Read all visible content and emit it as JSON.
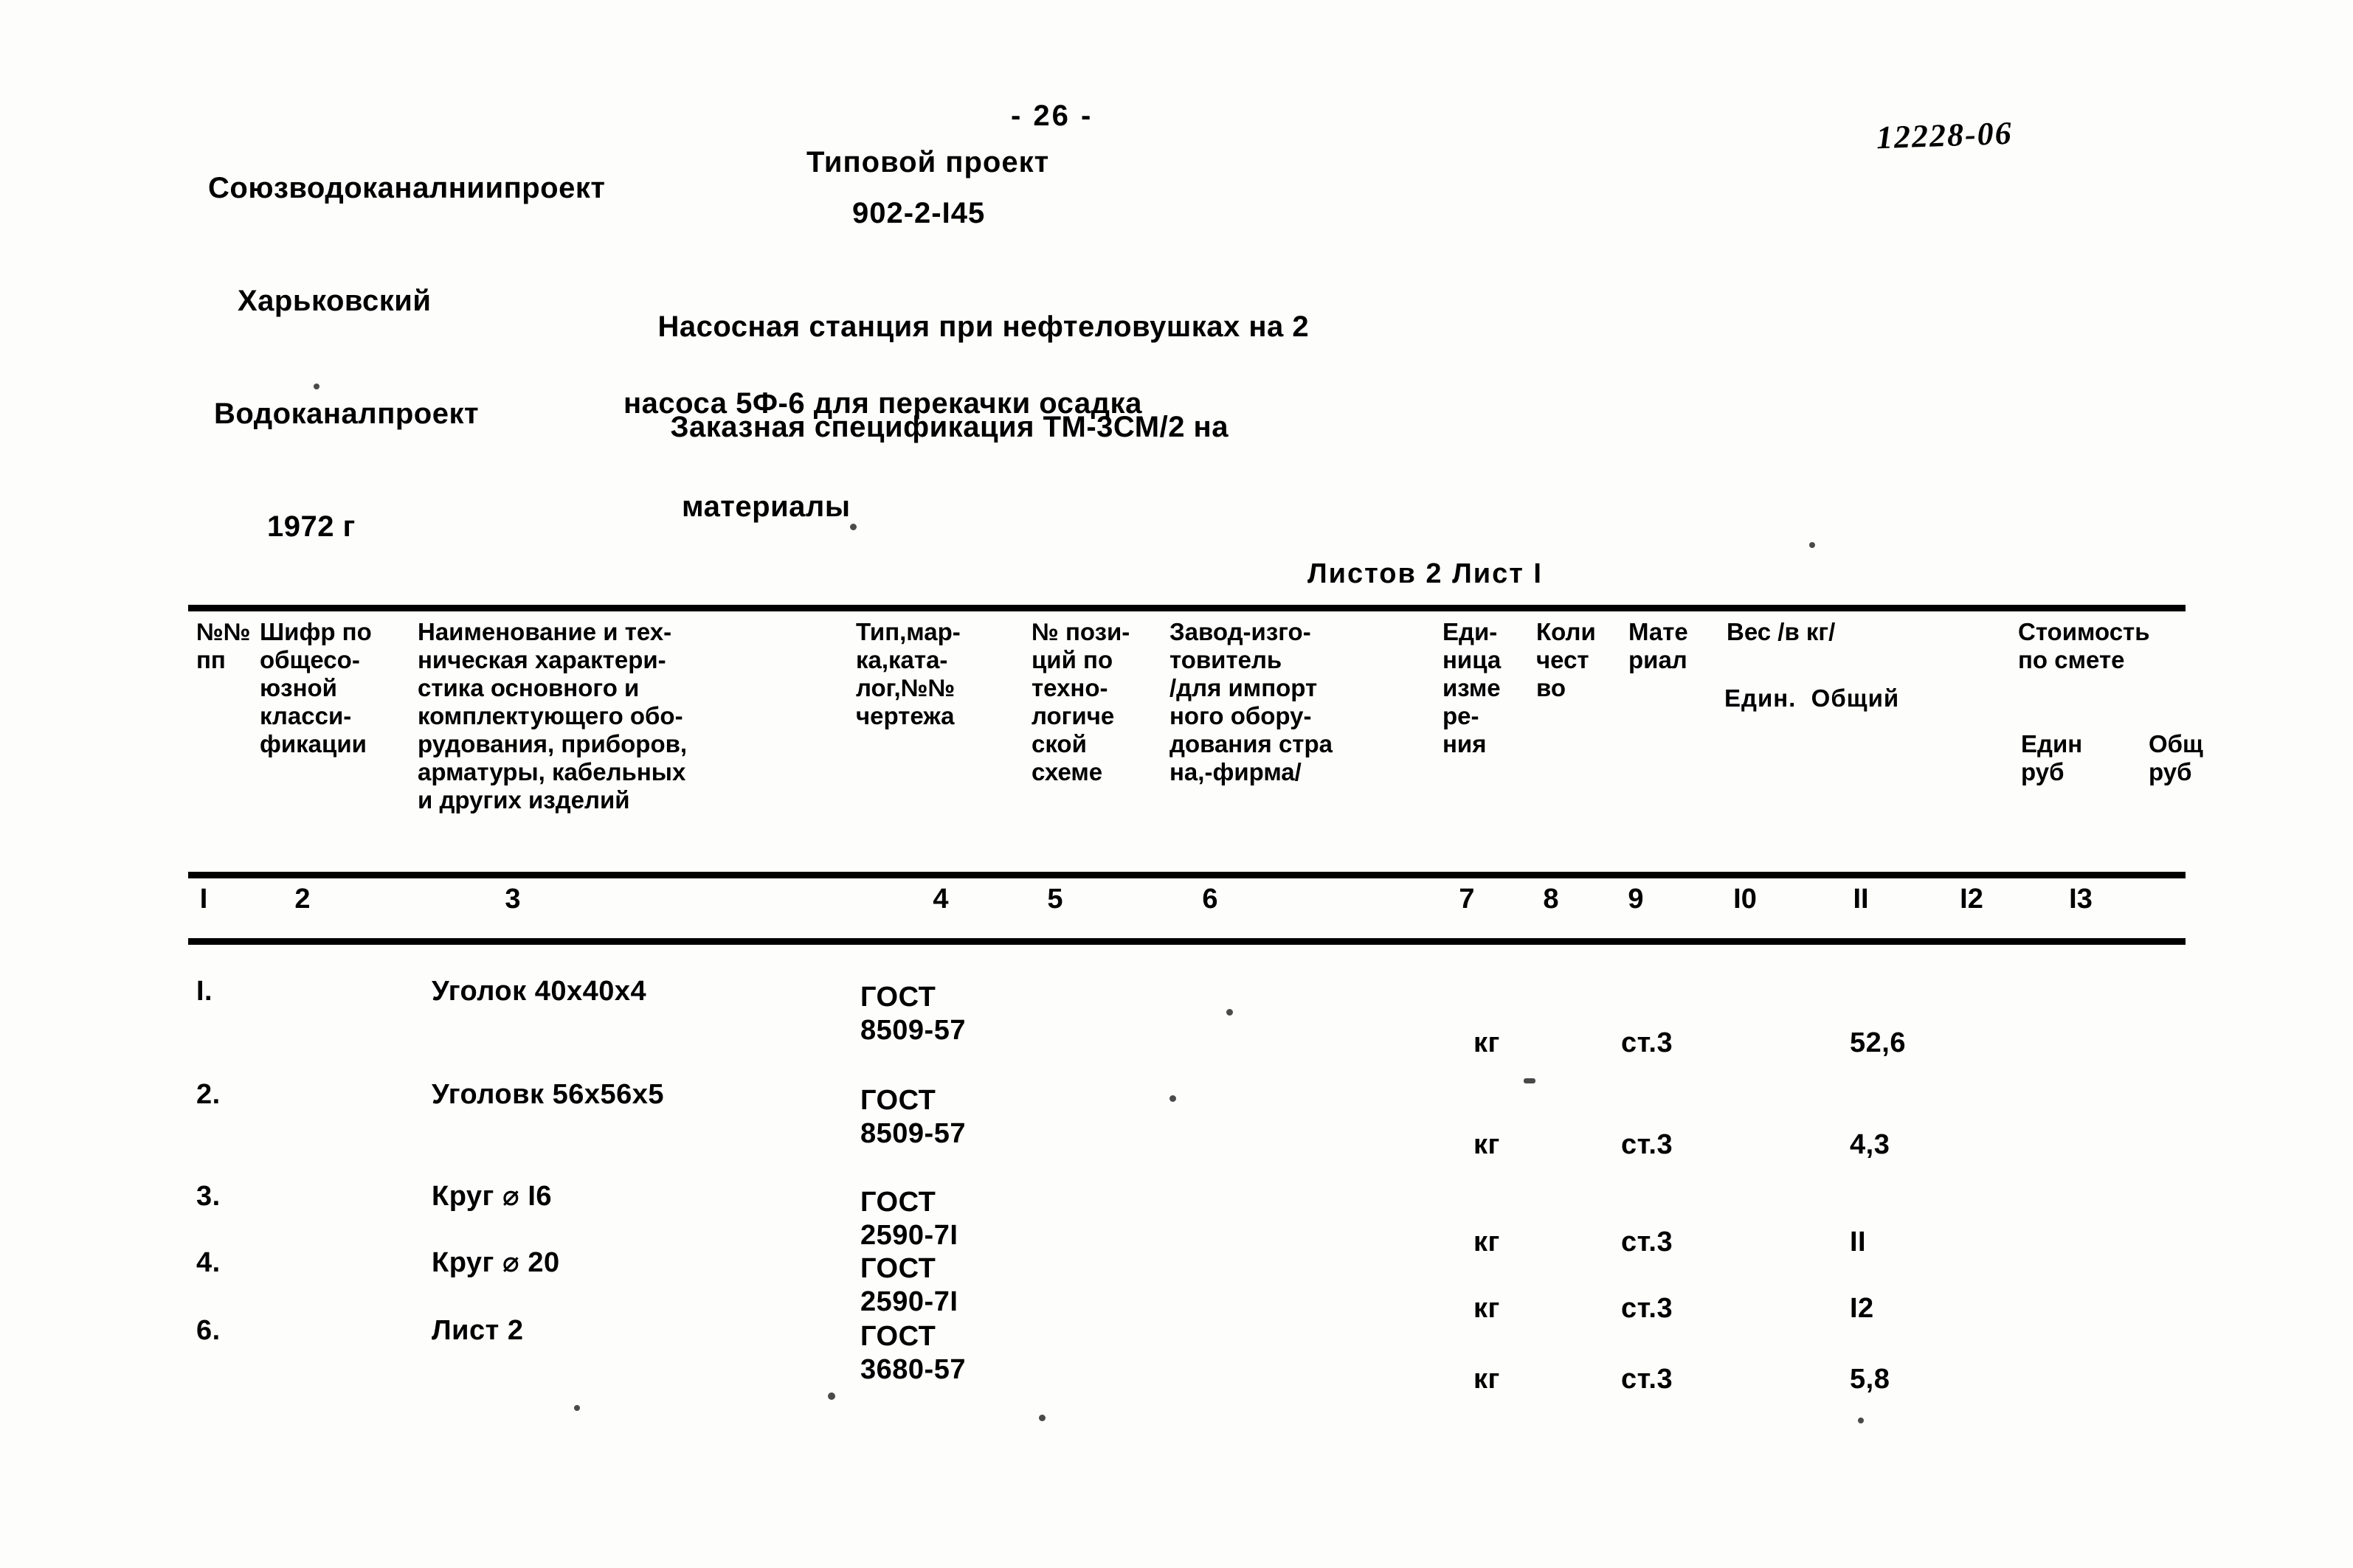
{
  "header": {
    "organization_line1": "Союзводоканалниипроект",
    "organization_line2": "Харьковский",
    "organization_line3": "Водоканалпроект",
    "organization_line4": "1972 г",
    "page_number": "- 26 -",
    "project_type": "Типовой проект",
    "project_code": "902-2-I45",
    "archive_code": "12228-06"
  },
  "title": {
    "line1": "Насосная станция при нефтеловушках на 2",
    "line2": "насоса 5Ф-6 для перекачки осадка",
    "subtitle1": "Заказная спецификация ТМ-3СМ/2 на",
    "subtitle2": "материалы"
  },
  "sheet_info": "Листов 2 Лист I",
  "table": {
    "headers": [
      "№№\nпп",
      "Шифр по\nобщесо-\nюзной\nкласси-\nфикации",
      "Наименование и тех-\nническая характери-\nстика основного и\nкомплектующего обо-\nрудования, приборов,\nарматуры, кабельных\nи других изделий",
      "Тип,мар-\nка,ката-\nлог,№№\nчертежа",
      "№ пози-\nций по\nтехно-\nлогиче\nской\nсхеме",
      "Завод-изго-\nтовитель\n/для импорт\nного обору-\nдования стра\nна,-фирма/",
      "Еди-\nница\nизме\nре-\nния",
      "Коли\nчест\nво",
      "Мате\nриал",
      "Вес /в кг/",
      "Стоимость\nпо смете"
    ],
    "sub_weight": "Един.  Общий",
    "sub_cost_unit": "Един\nруб",
    "sub_cost_total": "Общ\nруб",
    "column_numbers": [
      "I",
      "2",
      "3",
      "4",
      "5",
      "6",
      "7",
      "8",
      "9",
      "I0",
      "II",
      "I2",
      "I3"
    ],
    "rows": [
      {
        "num": "I.",
        "name": "Уголок 40х40х4",
        "gost": "ГОСТ\n8509-57",
        "position": "",
        "manufacturer": "",
        "unit": "кг",
        "quantity": "",
        "material": "ст.3",
        "weight_unit": "52,6",
        "weight_total": "",
        "cost_unit": "",
        "cost_total": ""
      },
      {
        "num": "2.",
        "name": "Уголовк 56х56х5",
        "gost": "ГОСТ\n8509-57",
        "position": "",
        "manufacturer": "",
        "unit": "кг",
        "quantity": "",
        "material": "ст.3",
        "weight_unit": "4,3",
        "weight_total": "",
        "cost_unit": "",
        "cost_total": ""
      },
      {
        "num": "3.",
        "name": "Круг ⌀ I6",
        "gost": "ГОСТ\n2590-7I",
        "position": "",
        "manufacturer": "",
        "unit": "кг",
        "quantity": "",
        "material": "ст.3",
        "weight_unit": "II",
        "weight_total": "",
        "cost_unit": "",
        "cost_total": ""
      },
      {
        "num": "4.",
        "name": "Круг ⌀ 20",
        "gost": "ГОСТ\n2590-7I",
        "position": "",
        "manufacturer": "",
        "unit": "кг",
        "quantity": "",
        "material": "ст.3",
        "weight_unit": "I2",
        "weight_total": "",
        "cost_unit": "",
        "cost_total": ""
      },
      {
        "num": "6.",
        "name": "Лист 2",
        "gost": "ГОСТ\n3680-57",
        "position": "",
        "manufacturer": "",
        "unit": "кг",
        "quantity": "",
        "material": "ст.3",
        "weight_unit": "5,8",
        "weight_total": "",
        "cost_unit": "",
        "cost_total": ""
      }
    ]
  }
}
